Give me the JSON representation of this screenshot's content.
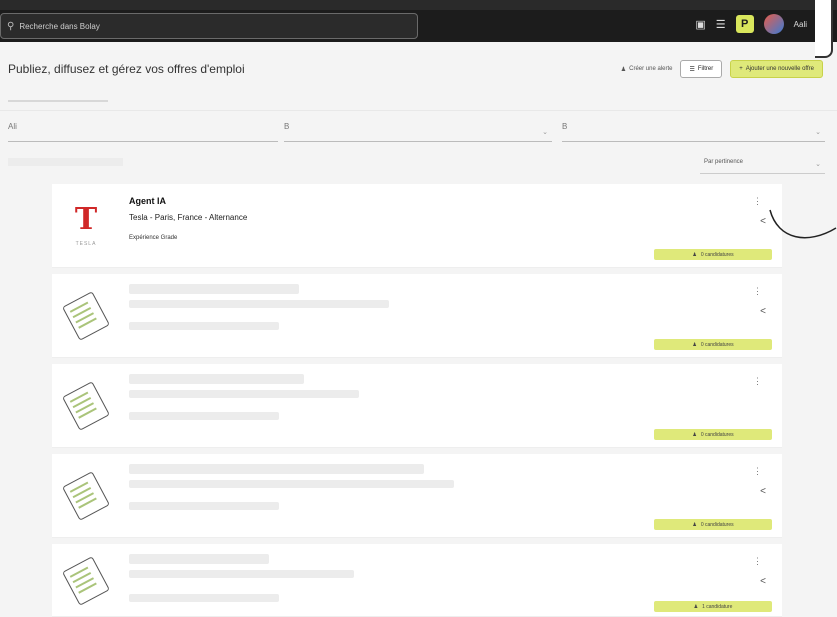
{
  "topbar": {
    "search_placeholder": "Recherche dans Bolay",
    "user_label": "Aali"
  },
  "header": {
    "title": "Publiez, diffusez et gérez vos offres d'emploi",
    "link_label": "Créer une alerte",
    "filter_label": "Filtrer",
    "add_label": "Ajouter une nouvelle offre"
  },
  "filters": {
    "first_value": "Ali",
    "second_value": "B",
    "third_value": "B"
  },
  "sort": {
    "label": "Par pertinence"
  },
  "jobs": [
    {
      "title": "Agent IA",
      "subtitle": "Tesla - Paris, France - Alternance",
      "meta": "Expérience Grade",
      "logo_text": "TESLA",
      "candidates": "0 candidatures"
    },
    {
      "candidates": "0 candidatures"
    },
    {
      "candidates": "0 candidatures"
    },
    {
      "candidates": "0 candidatures"
    },
    {
      "candidates": "1 candidature"
    }
  ],
  "colors": {
    "accent": "#dfe97a",
    "topbar": "#1c1c1c",
    "tesla_red": "#d02828"
  }
}
